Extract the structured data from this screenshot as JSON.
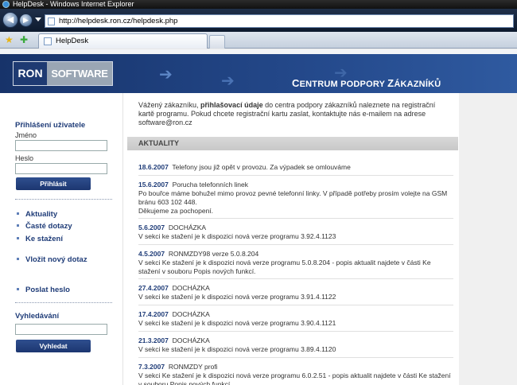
{
  "browser": {
    "window_title": "HelpDesk - Windows Internet Explorer",
    "url": "http://helpdesk.ron.cz/helpdesk.php",
    "tab_label": "HelpDesk",
    "icons": [
      "back-icon",
      "forward-icon",
      "favorites-star-icon",
      "add-favorites-icon",
      "page-icon"
    ]
  },
  "header": {
    "logo_left": "RON",
    "logo_right": "SOFTWARE",
    "banner_title_first": "C",
    "banner_title_rest_a": "ENTRUM PODPORY ",
    "banner_title_big": "Z",
    "banner_title_rest_b": "ÁKAZNÍKŮ",
    "colors": {
      "dark_blue": "#1e3a72",
      "accent_blue": "#1f3c78"
    }
  },
  "sidebar": {
    "login_title": "Přihlášení uživatele",
    "name_label": "Jméno",
    "password_label": "Heslo",
    "login_button": "Přihlásit",
    "links": [
      {
        "label": "Aktuality"
      },
      {
        "label": "Časté dotazy"
      },
      {
        "label": "Ke stažení"
      },
      {
        "label": "Vložit nový dotaz"
      },
      {
        "label": "Poslat heslo"
      }
    ],
    "search_title": "Vyhledávání",
    "search_button": "Vyhledat"
  },
  "main": {
    "intro_a": "Vážený zákazníku, ",
    "intro_bold": "přihlašovací údaje",
    "intro_b": " do centra podpory zákazníků naleznete na registrační kartě programu. Pokud chcete registrační kartu zaslat, kontaktujte nás e-mailem na adrese software@ron.cz",
    "section_title": "AKTUALITY",
    "news": [
      {
        "date": "18.6.2007",
        "title": "Telefony jsou již opět v provozu. Za výpadek se omlouváme",
        "body": ""
      },
      {
        "date": "15.6.2007",
        "title": "Porucha telefonních linek",
        "body": "Po bouřce máme bohužel mimo provoz pevné telefonní linky. V případě potřeby prosím volejte na GSM bránu 603 102 448.\nDěkujeme za pochopení."
      },
      {
        "date": "5.6.2007",
        "title": "DOCHÁZKA",
        "body": "V sekci ke stažení je k dispozici nová verze programu 3.92.4.1123"
      },
      {
        "date": "4.5.2007",
        "title": "RONMZDY98 verze 5.0.8.204",
        "body": "V sekci Ke stažení je k dispozici nová verze programu 5.0.8.204 - popis aktualit najdete v části Ke stažení v souboru Popis nových funkcí."
      },
      {
        "date": "27.4.2007",
        "title": "DOCHÁZKA",
        "body": "V sekci ke stažení je k dispozici nová verze programu 3.91.4.1122"
      },
      {
        "date": "17.4.2007",
        "title": "DOCHÁZKA",
        "body": "V sekci ke stažení je k dispozici nová verze programu 3.90.4.1121"
      },
      {
        "date": "21.3.2007",
        "title": "DOCHÁZKA",
        "body": "V sekci ke stažení je k dispozici nová verze programu 3.89.4.1120"
      },
      {
        "date": "7.3.2007",
        "title": "RONMZDY profi",
        "body": "V sekci Ke stažení je k dispozici nová verze programu 6.0.2.51 - popis aktualit najdete v části Ke stažení v souboru Popis nových funkcí."
      }
    ]
  }
}
